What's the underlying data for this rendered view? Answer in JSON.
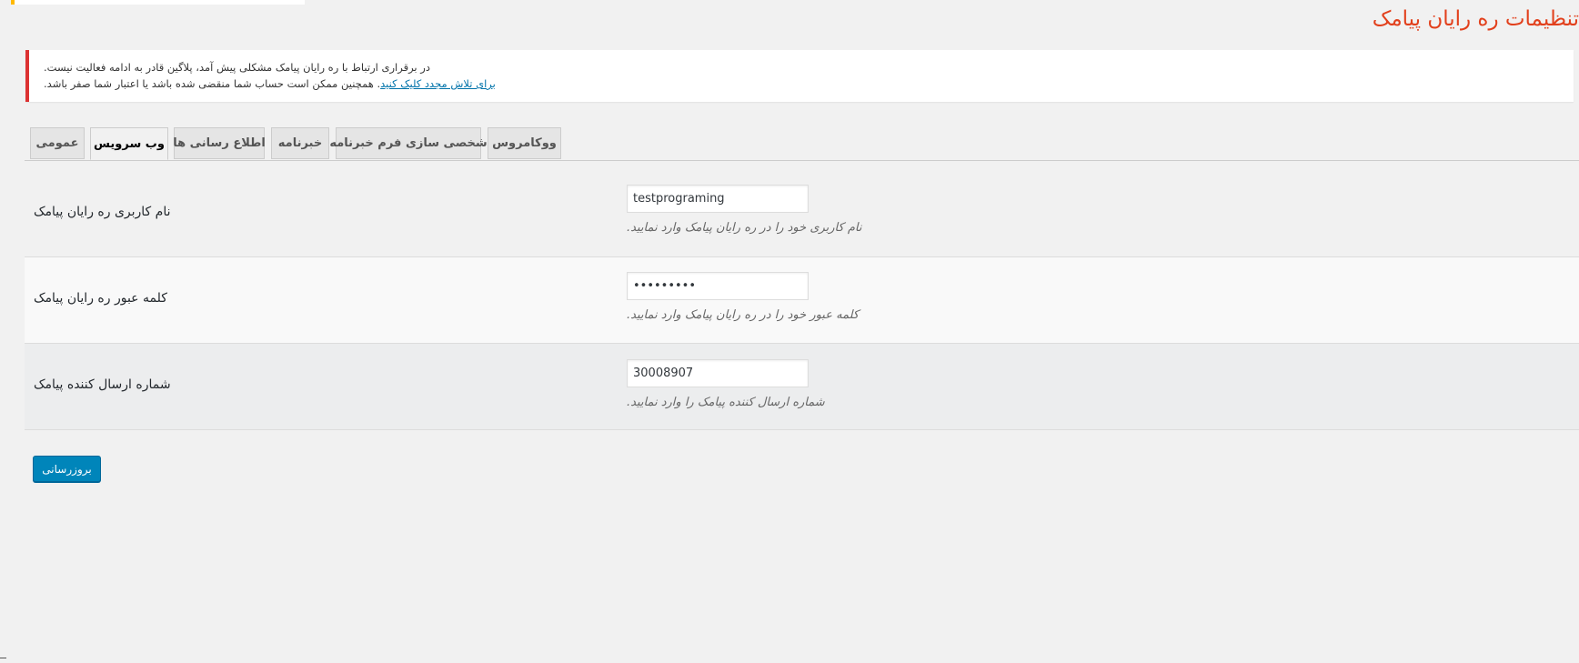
{
  "page": {
    "title": "تنظیمات ره رایان پیامک"
  },
  "notice": {
    "line1": ".در برقراری ارتباط با ره رایان پیامک مشکلی پیش آمد، پلاگین قادر به ادامه فعالیت نیست",
    "line2_prefix": ".",
    "line2_link": "برای تلاش مجدد کلیک کنید",
    "line2_suffix": "همچنین ممکن است حساب شما منقضی شده باشد یا اعتبار شما صفر باشد"
  },
  "tabs": [
    {
      "label": "عمومی",
      "active": false
    },
    {
      "label": "وب سرویس",
      "active": true
    },
    {
      "label": "اطلاع رسانی ها",
      "active": false
    },
    {
      "label": "خبرنامه",
      "active": false
    },
    {
      "label": "شخصی سازی فرم خبرنامه",
      "active": false
    },
    {
      "label": "ووکامروس",
      "active": false
    }
  ],
  "fields": {
    "username": {
      "label": "نام کاربری ره رایان پیامک",
      "value": "testprograming",
      "description": ".نام کاربری خود را در ره رایان پیامک وارد نمایید"
    },
    "password": {
      "label": "کلمه عبور ره رایان پیامک",
      "value": "123456789",
      "description": ".کلمه عبور خود را در ره رایان پیامک وارد نمایید"
    },
    "sender": {
      "label": "شماره ارسال کننده پیامک",
      "value": "30008907",
      "description": ".شماره ارسال کننده پیامک را وارد نمایید"
    }
  },
  "actions": {
    "submit_label": "بروزرسانی"
  },
  "colors": {
    "title": "#e2401c",
    "notice_border": "#dc3232",
    "link": "#0073aa",
    "primary_button": "#0085ba",
    "row_alt": "#f9f9f9",
    "row_highlight": "#ecedee"
  }
}
